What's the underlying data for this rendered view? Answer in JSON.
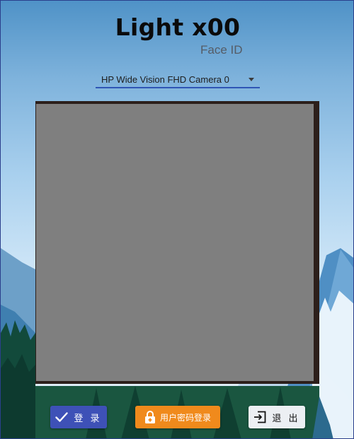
{
  "app": {
    "title": "Light x00",
    "subtitle": "Face ID"
  },
  "camera": {
    "selected": "HP Wide Vision FHD Camera 0"
  },
  "buttons": {
    "login": "登 录",
    "password_login": "用户密码登录",
    "exit": "退 出"
  },
  "colors": {
    "login_button": "#3e51b7",
    "password_button": "#f08a1c",
    "exit_button": "#eceff3",
    "select_underline": "#2f56b5",
    "video_placeholder": "#7f7f7f"
  },
  "icons": {
    "login": "check-icon",
    "password_login": "lock-icon",
    "exit": "exit-icon",
    "dropdown": "caret-down-icon"
  }
}
